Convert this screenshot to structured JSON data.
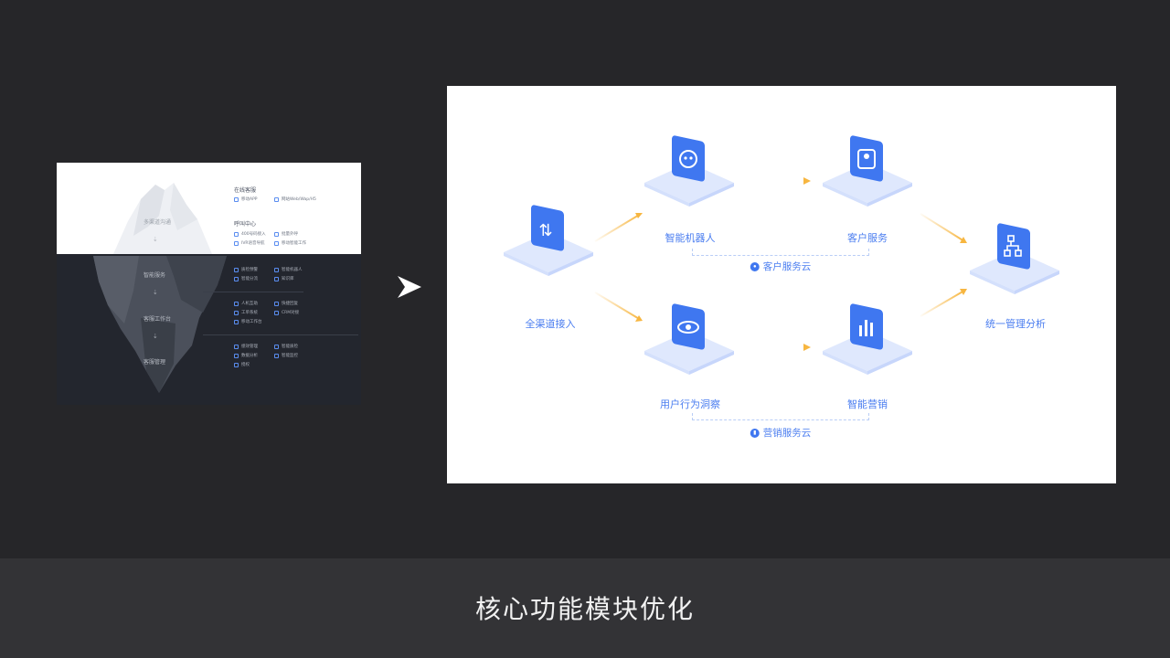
{
  "iceberg": {
    "layers": [
      "多渠道沟通",
      "智能服务",
      "客服工作台",
      "客服管理"
    ],
    "arrow_glyph": "⇣",
    "sections": [
      {
        "title": "在线客服",
        "features": [
          "移动APP",
          "网站Web/Wap/H5"
        ]
      },
      {
        "title": "呼叫中心",
        "features": [
          "400号码接入",
          "批量外呼",
          "IVR语音导航",
          "移动智能工作"
        ]
      }
    ],
    "service_features": [
      "质检预警",
      "智能机器人",
      "智能分流",
      "知识库"
    ],
    "workbench_features": [
      "人机互助",
      "快捷回复",
      "工单系统",
      "CRM对接",
      "移动工作台"
    ],
    "manage_features": [
      "绩效管理",
      "智能质检",
      "数据分析",
      "智能监控",
      "授权"
    ]
  },
  "diagram": {
    "nodes": {
      "all_channel": "全渠道接入",
      "robot": "智能机器人",
      "customer_service": "客户服务",
      "user_insight": "用户行为洞察",
      "marketing": "智能营销",
      "analysis": "统一管理分析"
    },
    "clouds": {
      "customer_cloud": "客户服务云",
      "marketing_cloud": "营销服务云"
    },
    "icons": {
      "all_channel": "transfer-icon",
      "robot": "robot-icon",
      "customer_service": "agent-icon",
      "user_insight": "eye-icon",
      "marketing": "bar-chart-icon",
      "analysis": "flow-icon"
    },
    "colors": {
      "accent": "#3f77f0",
      "arrow": "#f7b640",
      "tile": "#dfe8fd"
    }
  },
  "footer": {
    "title": "核心功能模块优化"
  }
}
